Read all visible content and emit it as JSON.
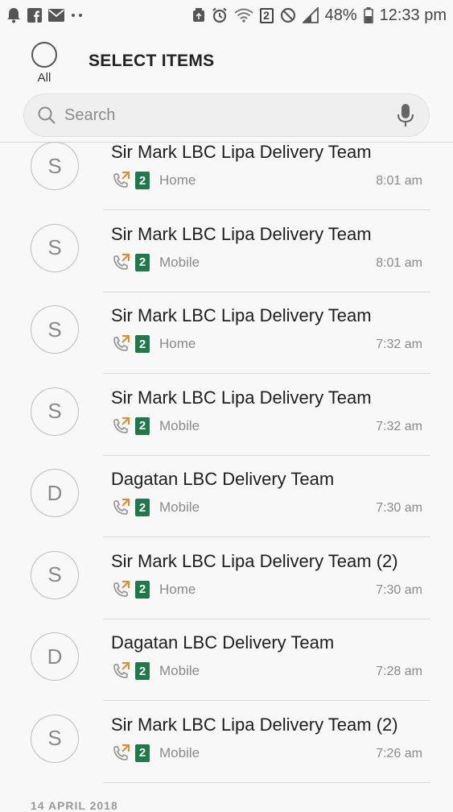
{
  "status_bar": {
    "battery": "48%",
    "time": "12:33 pm",
    "sim": "2",
    "icons_left": [
      "notification-bell-icon",
      "facebook-icon",
      "mail-icon",
      "more-dots-icon"
    ],
    "icons_right": [
      "recycle-icon",
      "alarm-icon",
      "wifi-icon",
      "sim-icon",
      "do-not-disturb-icon",
      "signal-icon",
      "battery-icon"
    ]
  },
  "header": {
    "select_all_label": "All",
    "title": "SELECT ITEMS"
  },
  "search": {
    "placeholder": "Search"
  },
  "calls": [
    {
      "initial": "S",
      "name": "Sir Mark LBC Lipa Delivery Team",
      "sim": "2",
      "type": "Home",
      "time": "8:01 am"
    },
    {
      "initial": "S",
      "name": "Sir Mark LBC Lipa Delivery Team",
      "sim": "2",
      "type": "Mobile",
      "time": "8:01 am"
    },
    {
      "initial": "S",
      "name": "Sir Mark LBC Lipa Delivery Team",
      "sim": "2",
      "type": "Home",
      "time": "7:32 am"
    },
    {
      "initial": "S",
      "name": "Sir Mark LBC Lipa Delivery Team",
      "sim": "2",
      "type": "Mobile",
      "time": "7:32 am"
    },
    {
      "initial": "D",
      "name": "Dagatan LBC Delivery Team",
      "sim": "2",
      "type": "Mobile",
      "time": "7:30 am"
    },
    {
      "initial": "S",
      "name": "Sir Mark LBC Lipa Delivery Team (2)",
      "sim": "2",
      "type": "Home",
      "time": "7:30 am"
    },
    {
      "initial": "D",
      "name": "Dagatan LBC Delivery Team",
      "sim": "2",
      "type": "Mobile",
      "time": "7:28 am"
    },
    {
      "initial": "S",
      "name": "Sir Mark LBC Lipa Delivery Team (2)",
      "sim": "2",
      "type": "Mobile",
      "time": "7:26 am"
    }
  ],
  "date_header": "14 APRIL 2018",
  "colors": {
    "sim_badge": "#1f7a4a",
    "outgoing_arrow": "#e8892b",
    "call_icon": "#9a9a9a"
  }
}
